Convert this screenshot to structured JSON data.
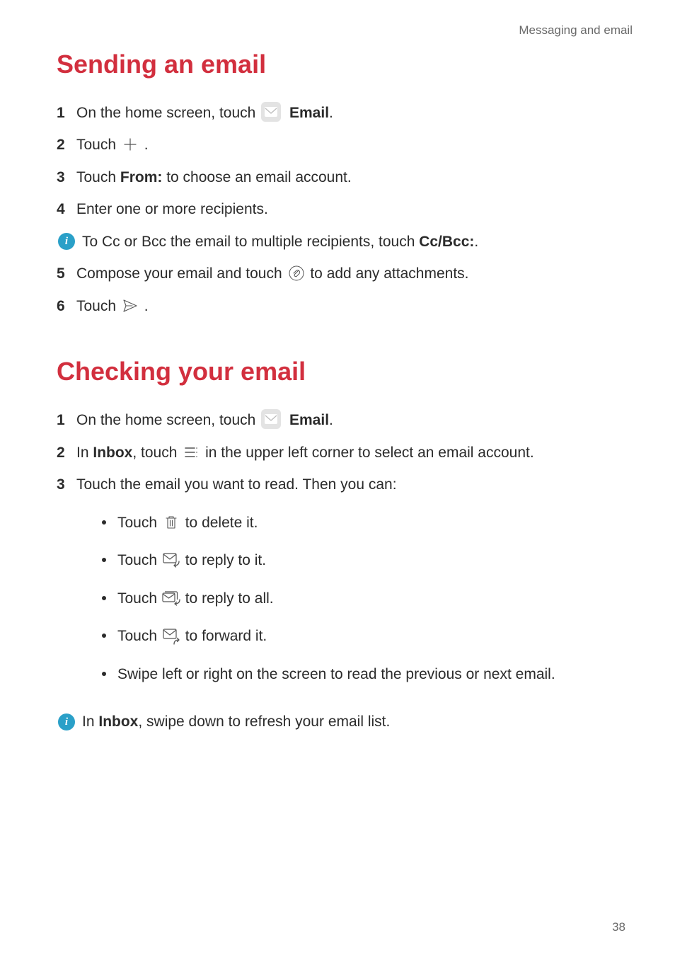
{
  "breadcrumb": "Messaging and email",
  "page_number": "38",
  "sending": {
    "title": "Sending an email",
    "steps": {
      "1": {
        "pre": "On the home screen, touch ",
        "bold": "Email",
        "post": "."
      },
      "2": {
        "pre": "Touch ",
        "post": " ."
      },
      "3": {
        "pre": "Touch ",
        "bold": "From:",
        "post": " to choose an email account."
      },
      "4": {
        "pre": "Enter one or more recipients."
      },
      "info": {
        "pre": "To Cc or Bcc the email to multiple recipients, touch ",
        "bold": "Cc/Bcc:",
        "post": "."
      },
      "5": {
        "pre": "Compose your email and touch ",
        "post": " to add any attachments."
      },
      "6": {
        "pre": "Touch ",
        "post": " ."
      }
    }
  },
  "checking": {
    "title": "Checking your email",
    "steps": {
      "1": {
        "pre": "On the home screen, touch ",
        "bold": "Email",
        "post": "."
      },
      "2": {
        "pre": "In ",
        "bold": "Inbox",
        "mid": ", touch ",
        "post": " in the upper left corner to select an email account."
      },
      "3": {
        "pre": "Touch the email you want to read. Then you can:"
      },
      "sub": {
        "a": {
          "pre": "Touch ",
          "post": " to delete it."
        },
        "b": {
          "pre": "Touch ",
          "post": " to reply to it."
        },
        "c": {
          "pre": "Touch ",
          "post": " to reply to all."
        },
        "d": {
          "pre": "Touch ",
          "post": " to forward it."
        },
        "e": {
          "pre": "Swipe left or right on the screen to read the previous or next email."
        }
      },
      "info": {
        "pre": "In ",
        "bold": "Inbox",
        "post": ", swipe down to refresh your email list."
      }
    }
  }
}
